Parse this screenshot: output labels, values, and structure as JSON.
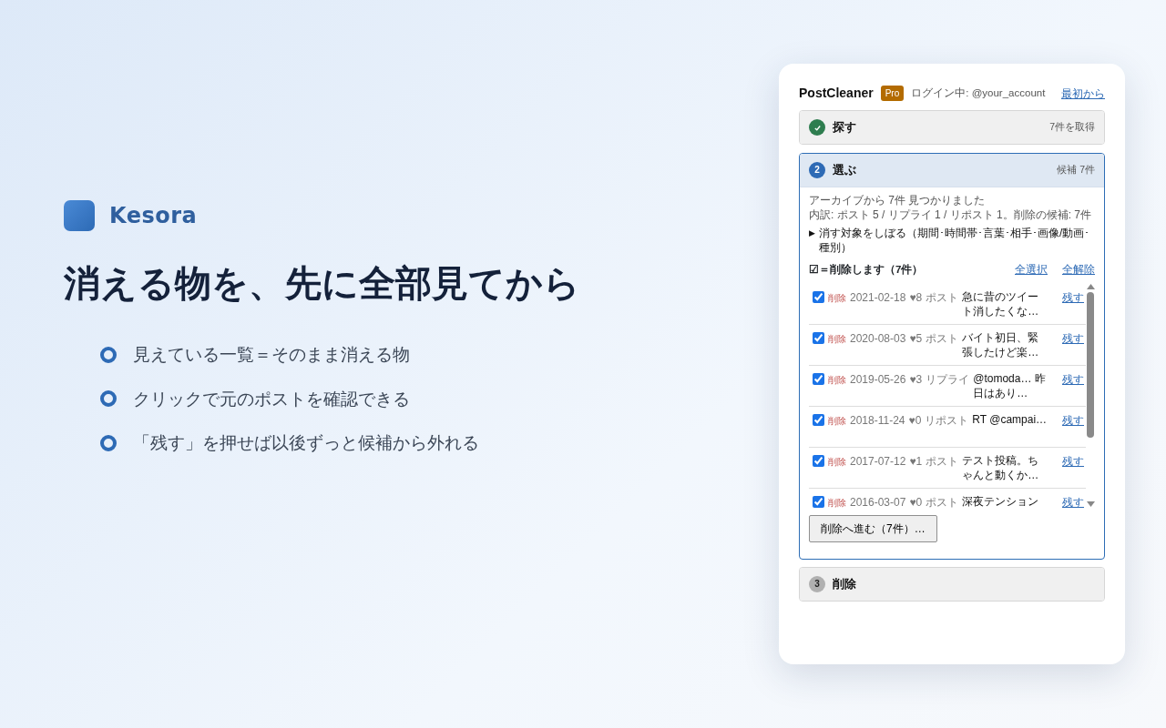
{
  "brand": {
    "name": "Kesora"
  },
  "headline": "消える物を、先に全部見てから",
  "bullets": [
    "見えている一覧＝そのまま消える物",
    "クリックで元のポストを確認できる",
    "「残す」を押せば以後ずっと候補から外れる"
  ],
  "panel": {
    "title": "PostCleaner",
    "badge": "Pro",
    "login": "ログイン中: @your_account",
    "restart_link": "最初から",
    "steps": [
      {
        "completed": true,
        "selected": false,
        "title": "探す",
        "summary": "7件を取得"
      },
      {
        "completed": false,
        "selected": true,
        "number": "2",
        "title": "選ぶ",
        "summary": "候補 7件",
        "found": "アーカイブから 7件 見つかりました",
        "breakdown": "内訳: ポスト 5 / リプライ 1 / リポスト 1。削除の候補: 7件",
        "filter": {
          "marker": "▶",
          "label": "消す対象をしぼる（期間･時間帯･言葉･相手･画像/動画･種別）",
          "expanded": false
        },
        "legend": "☑＝削除します（7件）",
        "select_all": "全選択",
        "deselect_all": "全解除",
        "rows": [
          {
            "checked": true,
            "tag": "削除",
            "date": "2021-02-18",
            "likes": "♥8",
            "type": "ポスト",
            "text": "急に昔のツイート消したくな…",
            "keep": "残す"
          },
          {
            "checked": true,
            "tag": "削除",
            "date": "2020-08-03",
            "likes": "♥5",
            "type": "ポスト",
            "text": "バイト初日、緊張したけど楽…",
            "keep": "残す"
          },
          {
            "checked": true,
            "tag": "削除",
            "date": "2019-05-26",
            "likes": "♥3",
            "type": "リプライ",
            "text": "@tomoda… 昨日はあり…",
            "keep": "残す"
          },
          {
            "checked": true,
            "tag": "削除",
            "date": "2018-11-24",
            "likes": "♥0",
            "type": "リポスト",
            "text": "RT @campai…",
            "keep": "残す"
          },
          {
            "checked": true,
            "tag": "削除",
            "date": "2017-07-12",
            "likes": "♥1",
            "type": "ポスト",
            "text": "テスト投稿。ちゃんと動くか…",
            "keep": "残す"
          },
          {
            "checked": true,
            "tag": "削除",
            "date": "2016-03-07",
            "likes": "♥0",
            "type": "ポスト",
            "text": "深夜テンション",
            "keep": "残す"
          }
        ],
        "proceed_button": "削除へ進む（7件）…"
      },
      {
        "completed": false,
        "selected": false,
        "number": "3",
        "title": "削除"
      }
    ]
  }
}
